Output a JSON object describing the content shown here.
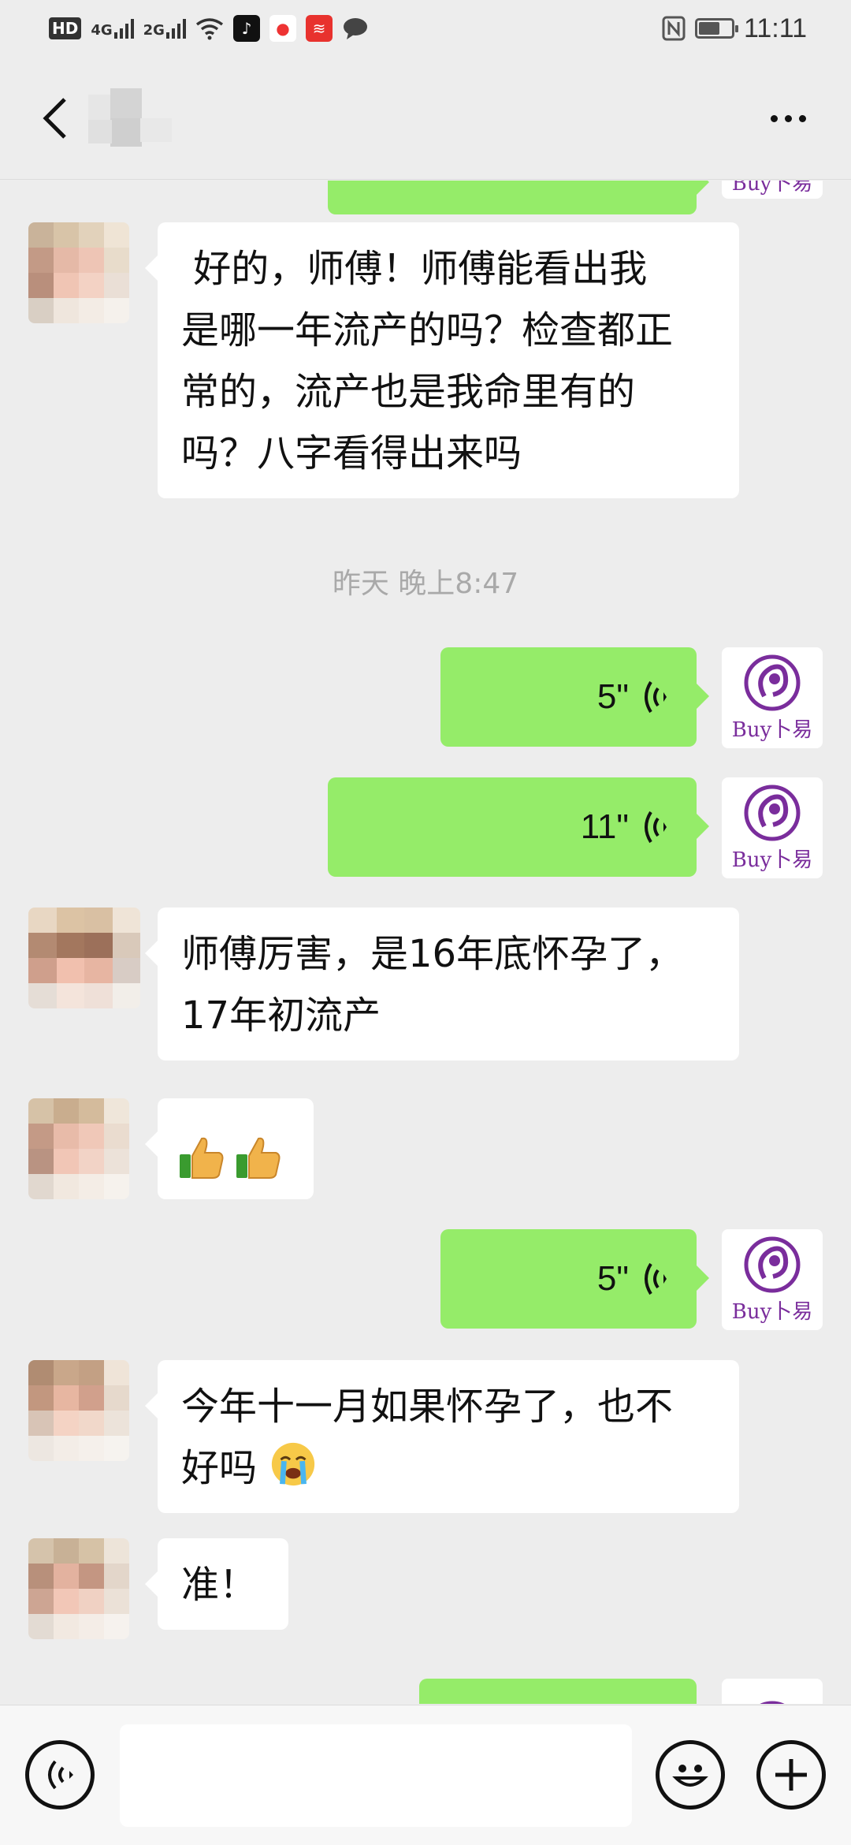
{
  "status_bar": {
    "hd_label": "HD",
    "net1": "4G",
    "net2": "2G",
    "time": "11:11"
  },
  "colors": {
    "accent_green": "#95ec69",
    "background": "#ededed",
    "logo_purple": "#7a2d9c"
  },
  "header": {
    "back_icon": "chevron-left-icon",
    "more_icon": "more-dots-icon"
  },
  "messages": [
    {
      "id": "m0",
      "side": "out",
      "type": "text",
      "text": ""
    },
    {
      "id": "m1",
      "side": "in",
      "type": "text",
      "lines": [
        " 好的，师傅！师傅能看出我",
        "是哪一年流产的吗？检查都正",
        "常的，流产也是我命里有的",
        "吗？八字看得出来吗"
      ]
    },
    {
      "id": "ts1",
      "type": "timestamp",
      "text": "昨天 晚上8:47"
    },
    {
      "id": "m2",
      "side": "out",
      "type": "voice",
      "duration": "5\""
    },
    {
      "id": "m3",
      "side": "out",
      "type": "voice",
      "duration": "11\""
    },
    {
      "id": "m4",
      "side": "in",
      "type": "text",
      "lines": [
        "师傅厉害，是16年底怀孕了，",
        "17年初流产"
      ]
    },
    {
      "id": "m5",
      "side": "in",
      "type": "emoji",
      "emojis": [
        "thumbs-up",
        "thumbs-up"
      ]
    },
    {
      "id": "m6",
      "side": "out",
      "type": "voice",
      "duration": "5\""
    },
    {
      "id": "m7",
      "side": "in",
      "type": "text",
      "lines": [
        "今年十一月如果怀孕了，也不",
        "好吗"
      ],
      "trailing_emoji": "crying-face"
    },
    {
      "id": "m8",
      "side": "in",
      "type": "text",
      "lines": [
        "准！"
      ]
    }
  ],
  "self_avatar": {
    "logo_text": "Buy卜易",
    "icon": "buyiyi-logo-icon"
  },
  "input_bar": {
    "voice_icon": "voice-mode-icon",
    "emoji_icon": "emoji-icon",
    "plus_icon": "plus-icon",
    "placeholder": ""
  }
}
